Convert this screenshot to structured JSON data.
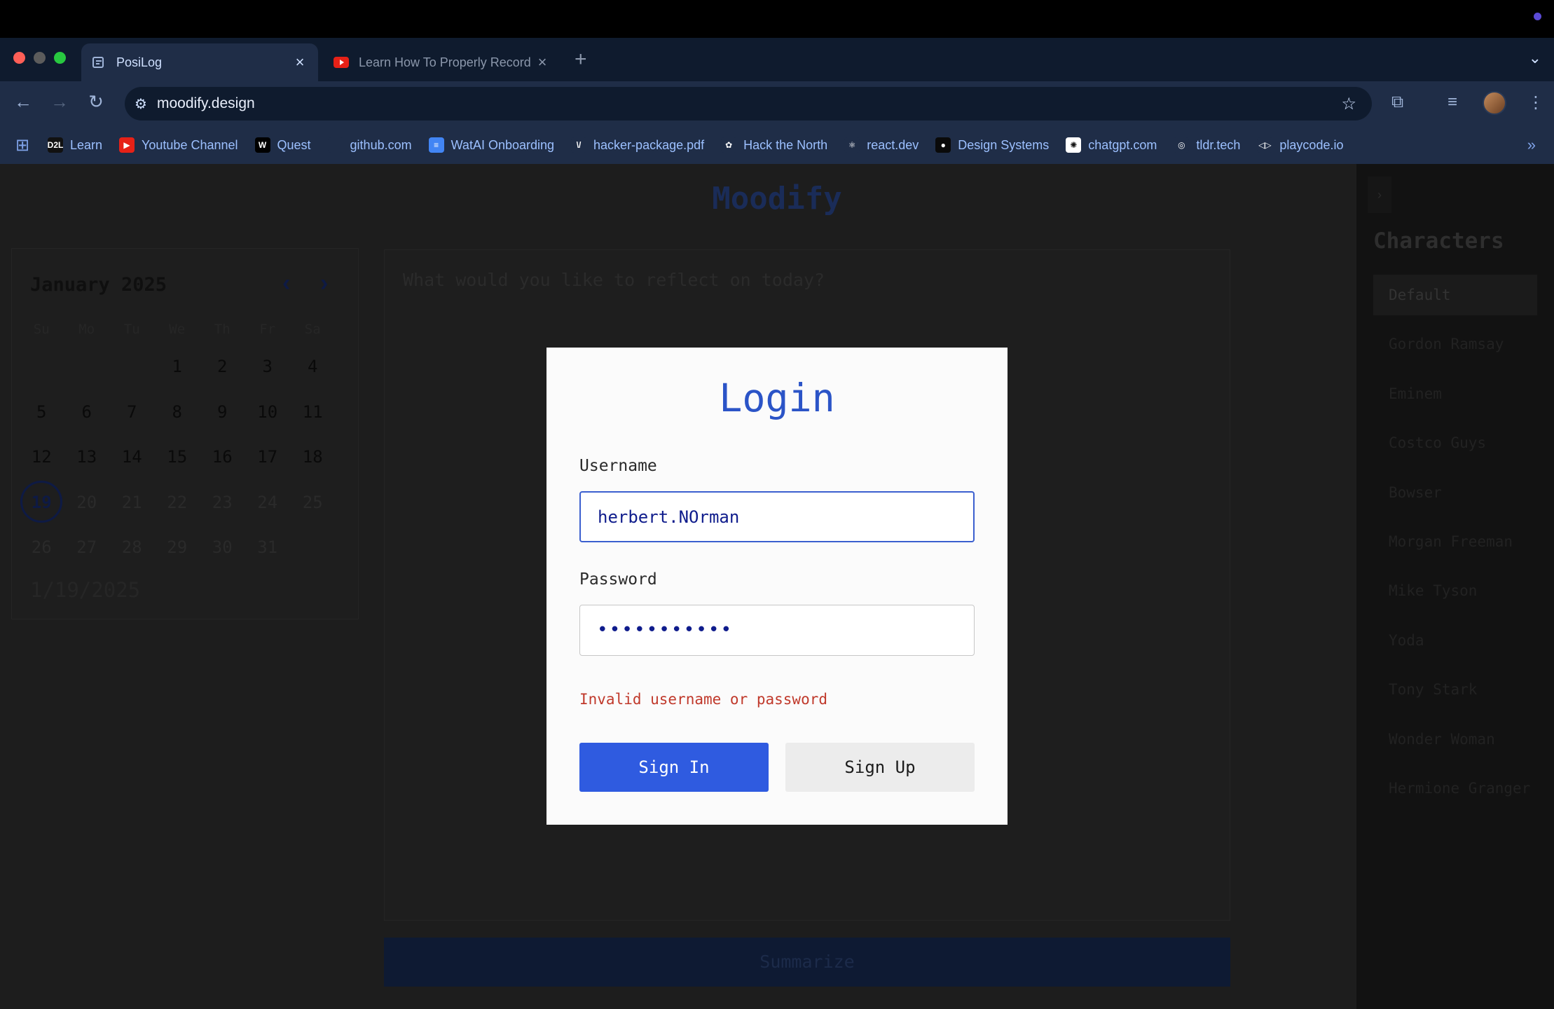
{
  "browser": {
    "tabs": [
      {
        "title": "PosiLog",
        "close": "×",
        "active": true
      },
      {
        "title": "Learn How To Properly Record",
        "close": "×",
        "active": false
      }
    ],
    "new_tab": "+",
    "tab_menu": "⌄",
    "url": "moodify.design",
    "icons": {
      "back": "←",
      "forward": "→",
      "reload": "↻",
      "site_info": "⚙",
      "star": "☆",
      "extensions": "⧉",
      "media": "≡",
      "menu": "⋮",
      "apps": "⊞",
      "more": "»"
    }
  },
  "bookmarks": [
    {
      "label": "Learn",
      "icon": "D2L",
      "color": "#111111"
    },
    {
      "label": "Youtube Channel",
      "icon": "▶",
      "color": "#e62117"
    },
    {
      "label": "Quest",
      "icon": "W",
      "color": "#000000"
    },
    {
      "label": "github.com",
      "icon": "",
      "color": "#1f2d47"
    },
    {
      "label": "WatAI Onboarding",
      "icon": "≡",
      "color": "#4285f4"
    },
    {
      "label": "hacker-package.pdf",
      "icon": "\\/",
      "color": "#1f2d47"
    },
    {
      "label": "Hack the North",
      "icon": "✿",
      "color": "#1f2d47"
    },
    {
      "label": "react.dev",
      "icon": "⚛",
      "color": "#1f2d47"
    },
    {
      "label": "Design Systems",
      "icon": "●",
      "color": "#0a0a0a"
    },
    {
      "label": "chatgpt.com",
      "icon": "✺",
      "color": "#ffffff"
    },
    {
      "label": "tldr.tech",
      "icon": "◎",
      "color": "#1f2d47"
    },
    {
      "label": "playcode.io",
      "icon": "◁▷",
      "color": "#1f2d47"
    }
  ],
  "app": {
    "title": "Moodify",
    "calendar": {
      "month_label": "January 2025",
      "prev": "‹",
      "next": "›",
      "weekdays": [
        "Su",
        "Mo",
        "Tu",
        "We",
        "Th",
        "Fr",
        "Sa"
      ],
      "leading_blanks": 3,
      "days": [
        1,
        2,
        3,
        4,
        5,
        6,
        7,
        8,
        9,
        10,
        11,
        12,
        13,
        14,
        15,
        16,
        17,
        18,
        19,
        20,
        21,
        22,
        23,
        24,
        25,
        26,
        27,
        28,
        29,
        30,
        31
      ],
      "today": 19,
      "selected_date": "1/19/2025"
    },
    "journal_placeholder": "What would you like to reflect on today?",
    "summarize_label": "Summarize",
    "characters": {
      "toggle": "›",
      "title": "Characters",
      "items": [
        "Default",
        "Gordon Ramsay",
        "Eminem",
        "Costco Guys",
        "Bowser",
        "Morgan Freeman",
        "Mike Tyson",
        "Yoda",
        "Tony Stark",
        "Wonder Woman",
        "Hermione Granger"
      ],
      "selected": "Default"
    }
  },
  "login": {
    "title": "Login",
    "username_label": "Username",
    "username_value": "herbert.NOrman",
    "password_label": "Password",
    "password_value": "•••••••••••",
    "error": "Invalid username or password",
    "sign_in": "Sign In",
    "sign_up": "Sign Up"
  },
  "colors": {
    "accent": "#2f5be0",
    "error": "#c0392b",
    "tab_bar": "#0f1b2e",
    "toolbar": "#1f2d47"
  }
}
